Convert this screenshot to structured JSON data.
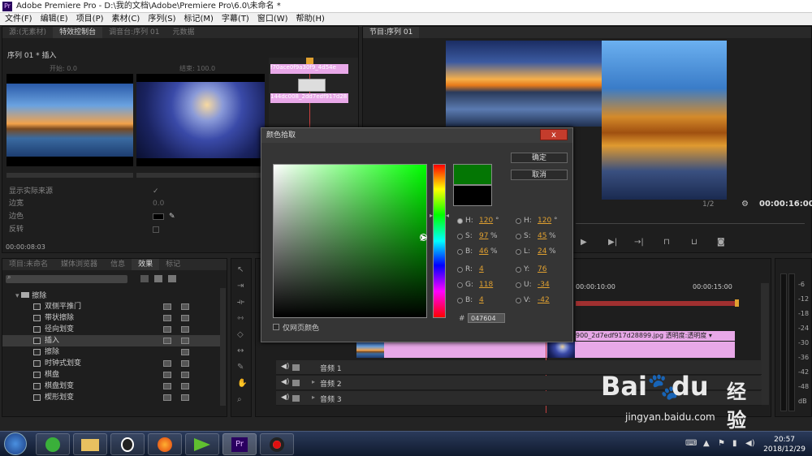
{
  "window_title": "Adobe Premiere Pro - D:\\我的文档\\Adobe\\Premiere Pro\\6.0\\未命名 *",
  "app_icon_label": "Pr",
  "menu": [
    "文件(F)",
    "编辑(E)",
    "项目(P)",
    "素材(C)",
    "序列(S)",
    "标记(M)",
    "字幕(T)",
    "窗口(W)",
    "帮助(H)"
  ],
  "source_panel": {
    "tabs": [
      "源:(无素材)",
      "特效控制台",
      "调音台:序列 01",
      "元数据"
    ],
    "header": "序列 01 * 插入",
    "start_label": "开始: 0.0",
    "end_label": "结束: 100.0",
    "clip_label_a": "f70ace0f9a3",
    "clip_label_b": "144dc008_2d",
    "clip_label_b_tail": "d7edf917d28",
    "clip_label_a_tail": "0f9_4d54e",
    "show_actual_source": "显示实际来源",
    "border_label": "边宽",
    "border_value": "0.0",
    "color_label": "边色",
    "reverse_label": "反转",
    "timecode": "00:00:08:03"
  },
  "program_panel": {
    "tab": "节目:序列 01",
    "zoom": "1/2",
    "timecode": "00:00:16:00"
  },
  "effects_panel": {
    "tabs": [
      "项目:未命名",
      "媒体浏览器",
      "信息",
      "效果",
      "标记"
    ],
    "folder": "擦除",
    "items": [
      "双侧平推门",
      "带状擦除",
      "径向划变",
      "插入",
      "擦除",
      "时钟式划变",
      "棋盘",
      "棋盘划变",
      "楔形划变"
    ]
  },
  "timeline": {
    "ruler_labels": [
      "00:00:10:00",
      "00:00:15:00"
    ],
    "clip_text": "900_2d7edf917d28899.jpg",
    "opacity_label": "透明度:透明度",
    "audio_tracks": [
      "音频 1",
      "音频 2",
      "音频 3"
    ]
  },
  "meter_ticks": [
    "-6",
    "-12",
    "-18",
    "-24",
    "-30",
    "-36",
    "-42",
    "-48",
    "dB"
  ],
  "color_picker": {
    "title": "颜色拾取",
    "close_symbol": "x",
    "ok_label": "确定",
    "cancel_label": "取消",
    "web_only_label": "仅网页颜色",
    "hex_prefix": "#",
    "hex_value": "047604",
    "new_color": "#047604",
    "old_color": "#000000",
    "hsb": {
      "h": "120",
      "s": "97",
      "b": "46"
    },
    "hsl": {
      "h": "120",
      "s": "45",
      "l": "24"
    },
    "rgb": {
      "r": "4",
      "g": "118",
      "b": "4"
    },
    "yuv": {
      "y": "76",
      "u": "-34",
      "v": "-42"
    },
    "labels": {
      "h": "H:",
      "s": "S:",
      "b": "B:",
      "l": "L:",
      "r": "R:",
      "g": "G:",
      "bb": "B:",
      "y": "Y:",
      "u": "U:",
      "v": "V:"
    },
    "deg": "°",
    "pct": "%"
  },
  "taskbar": {
    "time": "20:57",
    "date": "2018/12/29"
  },
  "watermark": {
    "brand": "Bai",
    "brand_tail": "du",
    "cn": "经验",
    "url": "jingyan.baidu.com"
  }
}
